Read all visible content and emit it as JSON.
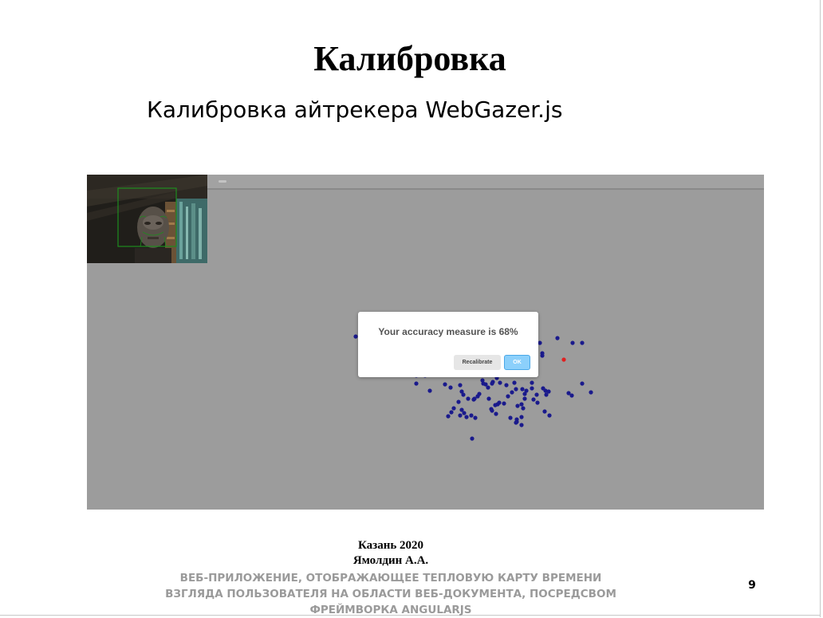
{
  "slide": {
    "title": "Калибровка",
    "subtitle": "Калибровка айтрекера WebGazer.js",
    "page_number": "9"
  },
  "footer": {
    "city_year": "Казань 2020",
    "author": "Ямолдин А.А.",
    "topic": "ВЕБ-ПРИЛОЖЕНИЕ, ОТОБРАЖАЮЩЕЕ ТЕПЛОВУЮ КАРТУ ВРЕМЕНИ ВЗГЛЯДА ПОЛЬЗОВАТЕЛЯ НА ОБЛАСТИ ВЕБ-ДОКУМЕНТА, ПОСРЕДСВОМ ФРЕЙМВОРКА ANGULARJS"
  },
  "calibration_dialog": {
    "message": "Your accuracy measure is 68%",
    "recalibrate_label": "Recalibrate",
    "ok_label": "OK"
  },
  "colors": {
    "gaze_point": "#1a1a8c",
    "current_gaze": "#e02020",
    "face_box": "#1e8c1e",
    "backdrop": "#9c9c9c",
    "ok_button": "#8cd0fb"
  }
}
